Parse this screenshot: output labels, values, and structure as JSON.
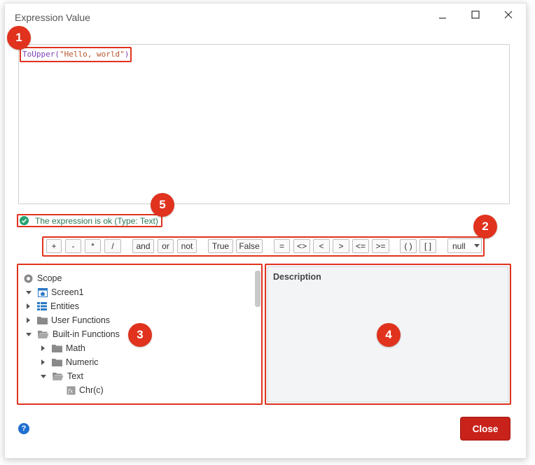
{
  "dialog": {
    "title": "Expression Value",
    "close_label": "Close",
    "help_glyph": "?"
  },
  "editor": {
    "code_func": "ToUpper(",
    "code_string": "\"Hello, world\"",
    "code_end": ")"
  },
  "status": {
    "text": "The expression is ok (Type: Text)"
  },
  "markers": [
    "1",
    "2",
    "3",
    "4",
    "5"
  ],
  "toolbar": {
    "operators": [
      "+",
      "-",
      "*",
      "/",
      "and",
      "or",
      "not",
      "True",
      "False",
      "=",
      "<>",
      "<",
      ">",
      "<=",
      ">=",
      "( )",
      "[ ]"
    ],
    "null_value": "null"
  },
  "tree": {
    "items": [
      {
        "label": "Scope",
        "icon": "radio-icon"
      },
      {
        "label": "Screen1",
        "icon": "screen-icon"
      },
      {
        "label": "Entities",
        "icon": "entities-icon"
      },
      {
        "label": "User Functions",
        "icon": "folder-icon"
      },
      {
        "label": "Built-in Functions",
        "icon": "folder-open-icon"
      },
      {
        "label": "Math",
        "icon": "folder-icon"
      },
      {
        "label": "Numeric",
        "icon": "folder-icon"
      },
      {
        "label": "Text",
        "icon": "folder-open-icon"
      },
      {
        "label": "Chr(c)",
        "icon": "function-icon"
      }
    ]
  },
  "description": {
    "title": "Description"
  },
  "colors": {
    "accent_red": "#e0321d",
    "ok_green": "#23a26d",
    "close_button": "#c8221a"
  }
}
